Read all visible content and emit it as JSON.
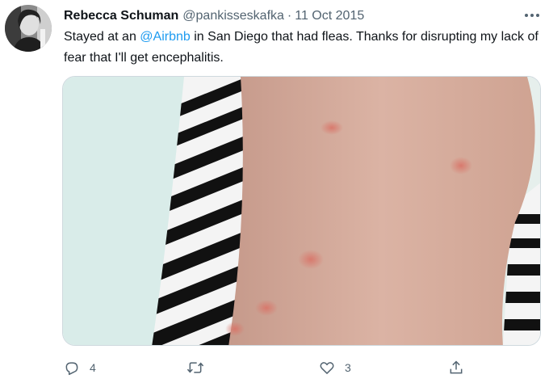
{
  "tweet": {
    "author": {
      "display_name": "Rebecca Schuman",
      "handle": "@pankisseskafka"
    },
    "separator": "·",
    "date": "11 Oct 2015",
    "text": {
      "before": "Stayed at an ",
      "mention": "@Airbnb",
      "after": " in San Diego that had fleas. Thanks for disrupting my lack of fear that I'll get encephalitis."
    },
    "media_alt": "Photo of an arm with red flea bites against a striped top",
    "actions": {
      "reply": {
        "icon": "reply-icon",
        "count": "4"
      },
      "retweet": {
        "icon": "retweet-icon",
        "count": ""
      },
      "like": {
        "icon": "heart-icon",
        "count": "3"
      },
      "share": {
        "icon": "share-icon"
      }
    },
    "more_icon": "more-icon"
  },
  "colors": {
    "text": "#0f1419",
    "secondary": "#536471",
    "link": "#1d9bf0",
    "border": "#cfd9de"
  }
}
